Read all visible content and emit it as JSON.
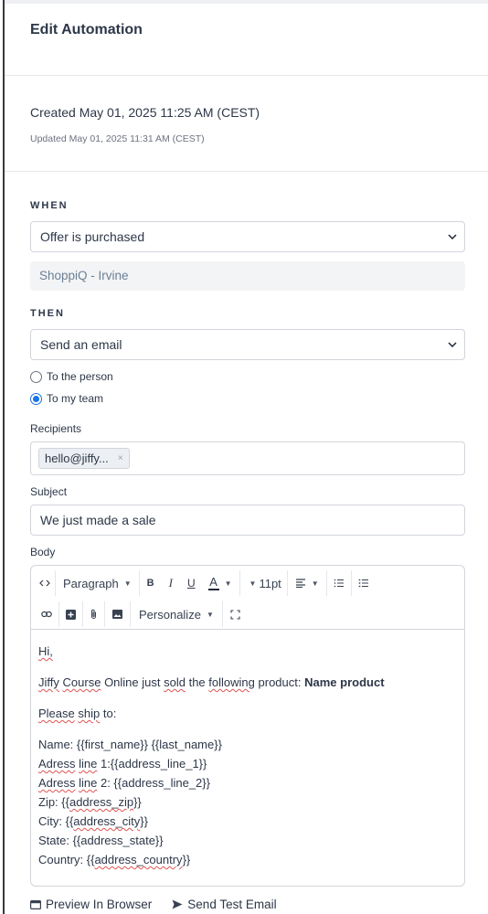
{
  "header": {
    "title": "Edit Automation"
  },
  "meta": {
    "created": "Created May 01, 2025 11:25 AM (CEST)",
    "updated": "Updated May 01, 2025 11:31 AM (CEST)"
  },
  "when": {
    "label": "WHEN",
    "trigger_value": "Offer is purchased",
    "offer_value": "ShoppiQ - Irvine"
  },
  "then": {
    "label": "THEN",
    "action_value": "Send an email",
    "radio_person": "To the person",
    "radio_team": "To my team",
    "selected_radio": "To my team"
  },
  "recipients": {
    "label": "Recipients",
    "tag": "hello@jiffy...",
    "tag_remove": "×"
  },
  "subject": {
    "label": "Subject",
    "value": "We just made a sale"
  },
  "body": {
    "label": "Body",
    "toolbar": {
      "paragraph": "Paragraph",
      "bold": "B",
      "italic": "I",
      "underline": "U",
      "font_color": "A",
      "font_size": "11pt",
      "personalize": "Personalize"
    },
    "content": {
      "greeting": "Hi,",
      "line1_parts": [
        "Jiffy",
        "Course",
        "Online just",
        "sold",
        "the",
        "following",
        "product:"
      ],
      "product": "Name product",
      "line2_parts": [
        "Please",
        "ship",
        "to:"
      ],
      "name_line": "Name: {{first_name}} {{last_name}}",
      "addr1_parts": [
        "Adress",
        "line",
        "1:{{address_line_1}}"
      ],
      "addr2_parts": [
        "Adress",
        "line",
        "2: {{address_line_2}}"
      ],
      "zip_parts": [
        "Zip: {{",
        "address_zip",
        "}}"
      ],
      "city_parts": [
        "City: {{",
        "address_city",
        "}}"
      ],
      "state_line": "State: {{address_state}}",
      "country_parts": [
        "Country: {{",
        "address_country",
        "}}"
      ]
    }
  },
  "footer": {
    "preview": "Preview In Browser",
    "send_test": "Send Test Email"
  },
  "colors": {
    "accent": "#1a73e8",
    "border": "#d1d5db",
    "text": "#2d3748",
    "muted": "#6b7f93"
  }
}
